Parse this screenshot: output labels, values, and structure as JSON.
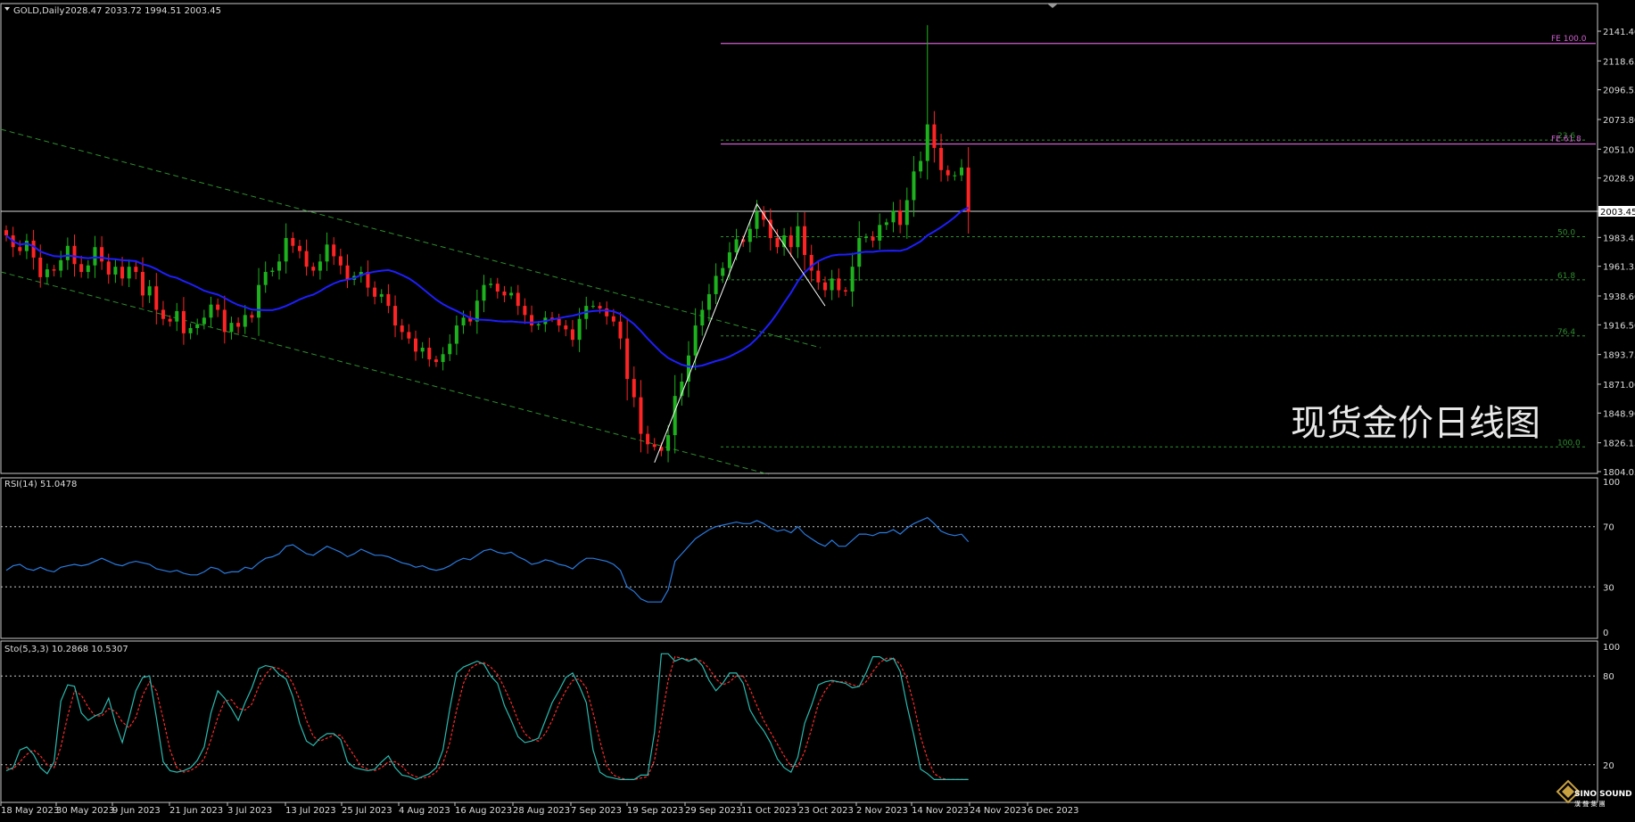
{
  "colors": {
    "background": "#000000",
    "frame": "#c8c8c8",
    "bull_candle": "#1db21d",
    "bear_candle": "#ff2424",
    "ma_line": "#1e1eff",
    "channel_line": "#2f8f2f",
    "fib_level": "#2f8f2f",
    "fe_line": "#d060d0",
    "rsi_line": "#2a7be0",
    "sto_main": "#2abab0",
    "sto_signal": "#ff2a2a",
    "text": "#dcdcdc"
  },
  "header": {
    "symbol_label": "GOLD,Daily",
    "ohlc_label": "2028.47 2033.72 1994.51 2003.45"
  },
  "watermark": {
    "title": "现货金价日线图",
    "logo_text_top": "SINO SOUND",
    "logo_text_bottom": "漢 聲 集 團"
  },
  "chart_data": [
    {
      "type": "candlestick",
      "symbol": "GOLD",
      "timeframe": "Daily",
      "current_price": "2003.45",
      "ylim": [
        1804.05,
        2141.4
      ],
      "y_ticks": [
        "2141.40",
        "2118.65",
        "2096.55",
        "2073.80",
        "2051.05",
        "2028.95",
        "2003.45",
        "1983.45",
        "1961.35",
        "1938.60",
        "1916.50",
        "1893.75",
        "1871.00",
        "1848.90",
        "1826.15",
        "1804.05"
      ],
      "x_ticks": [
        "18 May 2023",
        "30 May 2023",
        "9 Jun 2023",
        "21 Jun 2023",
        "3 Jul 2023",
        "13 Jul 2023",
        "25 Jul 2023",
        "4 Aug 2023",
        "16 Aug 2023",
        "28 Aug 2023",
        "7 Sep 2023",
        "19 Sep 2023",
        "29 Sep 2023",
        "11 Oct 2023",
        "23 Oct 2023",
        "2 Nov 2023",
        "14 Nov 2023",
        "24 Nov 2023",
        "6 Dec 2023"
      ],
      "closes": [
        1985,
        1976,
        1973,
        1981,
        1968,
        1953,
        1959,
        1958,
        1966,
        1977,
        1963,
        1957,
        1962,
        1976,
        1965,
        1955,
        1961,
        1952,
        1961,
        1957,
        1939,
        1946,
        1928,
        1921,
        1919,
        1927,
        1910,
        1914,
        1917,
        1922,
        1932,
        1928,
        1911,
        1918,
        1915,
        1924,
        1922,
        1947,
        1957,
        1958,
        1965,
        1983,
        1977,
        1973,
        1961,
        1958,
        1965,
        1978,
        1969,
        1962,
        1951,
        1954,
        1957,
        1945,
        1938,
        1940,
        1931,
        1916,
        1911,
        1906,
        1896,
        1899,
        1890,
        1888,
        1894,
        1902,
        1916,
        1922,
        1919,
        1935,
        1947,
        1948,
        1942,
        1939,
        1941,
        1931,
        1924,
        1916,
        1917,
        1922,
        1921,
        1916,
        1913,
        1905,
        1921,
        1931,
        1931,
        1929,
        1923,
        1919,
        1906,
        1875,
        1861,
        1833,
        1825,
        1823,
        1820,
        1832,
        1862,
        1873,
        1893,
        1916,
        1928,
        1940,
        1954,
        1960,
        1972,
        1982,
        1980,
        1990,
        2003,
        1997,
        1983,
        1976,
        1985,
        1976,
        1992,
        1970,
        1958,
        1949,
        1943,
        1952,
        1943,
        1942,
        1961,
        1983,
        1984,
        1981,
        1993,
        1995,
        2004,
        1993,
        2012,
        2034,
        2042,
        2070,
        2052,
        2035,
        2031,
        2031,
        2037,
        2003
      ],
      "extreme_high": 2146,
      "moving_average_period": 20,
      "fibonacci_retracement": [
        {
          "label": "23.6",
          "price": 2058
        },
        {
          "label": "50.0",
          "price": 1984
        },
        {
          "label": "61.8",
          "price": 1951
        },
        {
          "label": "76.4",
          "price": 1908
        },
        {
          "label": "100.0",
          "price": 1823
        }
      ],
      "fibonacci_expansion": [
        {
          "label": "FE 100.0",
          "price": 2132
        },
        {
          "label": "FE 61.8",
          "price": 2055
        }
      ]
    },
    {
      "type": "line",
      "indicator": "RSI(14)",
      "header_label": "RSI(14) 51.0478",
      "last_value": 51.0478,
      "ylim": [
        0,
        100
      ],
      "y_ticks": [
        "100",
        "70",
        "30",
        "0"
      ],
      "levels": [
        70,
        30
      ],
      "values": [
        41,
        44,
        45,
        42,
        41,
        43,
        41,
        40,
        43,
        44,
        45,
        44,
        45,
        47,
        49,
        47,
        45,
        44,
        46,
        47,
        46,
        45,
        42,
        41,
        40,
        41,
        39,
        38,
        38,
        40,
        43,
        42,
        39,
        40,
        40,
        43,
        42,
        46,
        49,
        50,
        52,
        57,
        58,
        55,
        52,
        51,
        54,
        57,
        55,
        53,
        50,
        52,
        55,
        53,
        51,
        51,
        50,
        48,
        46,
        45,
        43,
        44,
        42,
        41,
        42,
        44,
        47,
        49,
        48,
        51,
        54,
        55,
        53,
        52,
        53,
        50,
        48,
        45,
        46,
        48,
        47,
        45,
        44,
        42,
        46,
        49,
        49,
        48,
        47,
        45,
        41,
        30,
        27,
        22,
        20,
        20,
        20,
        28,
        47,
        52,
        57,
        62,
        65,
        68,
        70,
        71,
        72,
        73,
        72,
        72,
        74,
        72,
        69,
        67,
        68,
        66,
        70,
        65,
        62,
        59,
        57,
        61,
        57,
        57,
        61,
        65,
        65,
        64,
        66,
        66,
        68,
        65,
        69,
        72,
        74,
        76,
        72,
        67,
        65,
        64,
        65,
        60
      ]
    },
    {
      "type": "line",
      "indicator": "Sto(5,3,3)",
      "header_label": "Sto(5,3,3) 10.2868 10.5307",
      "main_value": 10.2868,
      "signal_value": 10.5307,
      "ylim": [
        0,
        100
      ],
      "y_ticks": [
        "100",
        "80",
        "20"
      ],
      "levels": [
        80,
        20
      ],
      "series": [
        {
          "name": "Main",
          "values": [
            16,
            18,
            30,
            32,
            27,
            18,
            14,
            22,
            63,
            74,
            73,
            55,
            50,
            53,
            55,
            65,
            48,
            35,
            52,
            70,
            79,
            80,
            52,
            22,
            16,
            15,
            16,
            18,
            23,
            32,
            55,
            70,
            65,
            58,
            50,
            62,
            72,
            85,
            87,
            86,
            81,
            78,
            66,
            48,
            36,
            33,
            38,
            41,
            41,
            37,
            22,
            18,
            17,
            16,
            17,
            22,
            26,
            18,
            13,
            12,
            10,
            12,
            14,
            18,
            30,
            58,
            82,
            86,
            88,
            90,
            88,
            80,
            75,
            60,
            50,
            39,
            35,
            36,
            38,
            50,
            62,
            70,
            79,
            82,
            73,
            62,
            30,
            15,
            12,
            11,
            10,
            10,
            10,
            13,
            13,
            42,
            95,
            95,
            90,
            92,
            90,
            92,
            87,
            77,
            70,
            75,
            82,
            82,
            75,
            57,
            49,
            43,
            35,
            24,
            18,
            15,
            25,
            48,
            60,
            74,
            76,
            77,
            76,
            75,
            72,
            73,
            82,
            93,
            93,
            90,
            92,
            83,
            60,
            40,
            17,
            14,
            10,
            10,
            10,
            10,
            10,
            10
          ]
        },
        {
          "name": "Signal",
          "values": [
            18,
            17,
            22,
            27,
            30,
            26,
            20,
            18,
            32,
            53,
            70,
            67,
            59,
            53,
            53,
            58,
            56,
            49,
            45,
            52,
            67,
            76,
            70,
            51,
            30,
            18,
            15,
            16,
            19,
            24,
            37,
            52,
            63,
            64,
            58,
            57,
            61,
            73,
            81,
            86,
            85,
            82,
            75,
            64,
            50,
            39,
            36,
            38,
            40,
            40,
            33,
            26,
            19,
            17,
            16,
            18,
            22,
            22,
            19,
            14,
            12,
            11,
            12,
            15,
            21,
            35,
            57,
            75,
            85,
            88,
            89,
            86,
            81,
            72,
            62,
            50,
            41,
            37,
            36,
            41,
            50,
            61,
            70,
            77,
            78,
            72,
            55,
            36,
            19,
            13,
            11,
            10,
            10,
            11,
            12,
            23,
            50,
            77,
            93,
            92,
            91,
            91,
            90,
            85,
            78,
            74,
            76,
            80,
            80,
            71,
            60,
            50,
            42,
            34,
            26,
            19,
            19,
            29,
            44,
            61,
            70,
            76,
            76,
            76,
            74,
            73,
            76,
            83,
            89,
            92,
            92,
            88,
            78,
            61,
            39,
            24,
            14,
            11,
            10,
            10,
            10,
            10
          ]
        }
      ]
    }
  ]
}
